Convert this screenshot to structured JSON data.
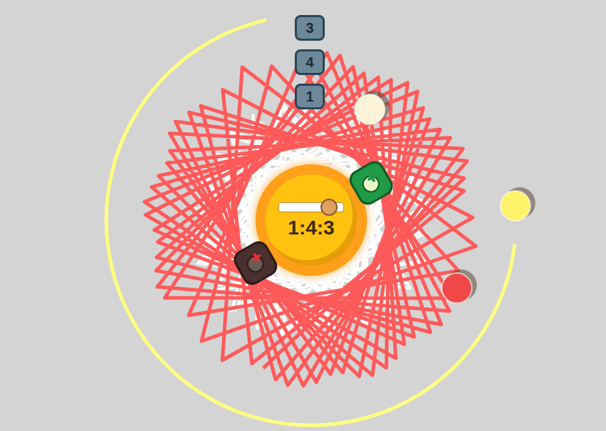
{
  "ratio": {
    "text": "1:4:3",
    "level": 0.76
  },
  "badges": [
    "3",
    "4",
    "1"
  ],
  "traces": [
    {
      "color": "#ff5a5a"
    },
    {
      "color": "#ffffff"
    },
    {
      "color": "#ffff80"
    }
  ],
  "planets": [
    {
      "color": "#fdf3d8"
    },
    {
      "color": "#fff36b"
    },
    {
      "color": "#f04848"
    }
  ],
  "buttons": [
    {
      "kind": "add"
    },
    {
      "kind": "remove"
    }
  ]
}
